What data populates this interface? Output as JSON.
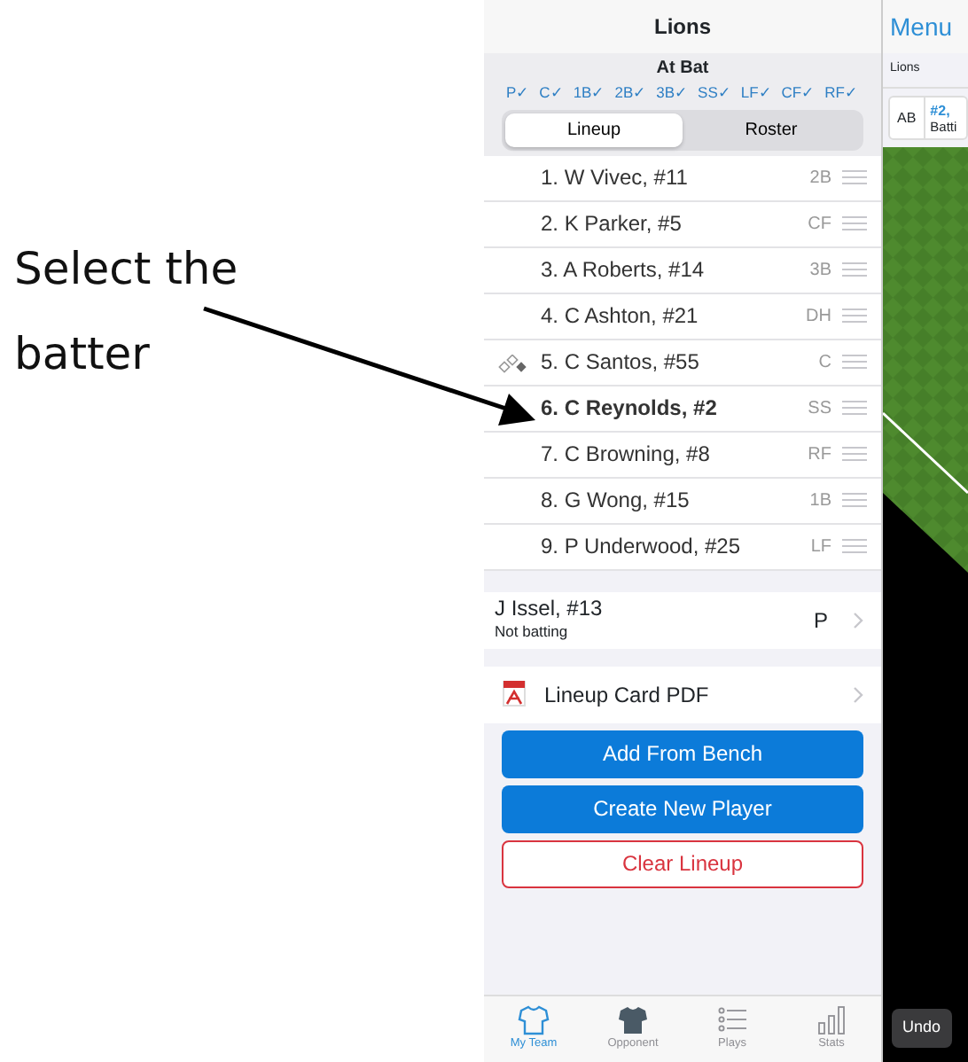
{
  "annotation": {
    "text": "Select the batter"
  },
  "lineup_panel": {
    "title": "Lions",
    "section_title": "At Bat",
    "positions": [
      "P✓",
      "C✓",
      "1B✓",
      "2B✓",
      "3B✓",
      "SS✓",
      "LF✓",
      "CF✓",
      "RF✓"
    ],
    "tabs": [
      {
        "label": "Lineup",
        "selected": true
      },
      {
        "label": "Roster",
        "selected": false
      }
    ],
    "lineup": [
      {
        "text": "1. W Vivec, #11",
        "position": "2B",
        "selected": false,
        "base_icon": false
      },
      {
        "text": "2. K Parker, #5",
        "position": "CF",
        "selected": false,
        "base_icon": false
      },
      {
        "text": "3. A Roberts, #14",
        "position": "3B",
        "selected": false,
        "base_icon": false
      },
      {
        "text": "4. C Ashton, #21",
        "position": "DH",
        "selected": false,
        "base_icon": false
      },
      {
        "text": "5. C Santos, #55",
        "position": "C",
        "selected": false,
        "base_icon": true
      },
      {
        "text": "6. C Reynolds, #2",
        "position": "SS",
        "selected": true,
        "base_icon": false
      },
      {
        "text": "7. C Browning, #8",
        "position": "RF",
        "selected": false,
        "base_icon": false
      },
      {
        "text": "8. G Wong, #15",
        "position": "1B",
        "selected": false,
        "base_icon": false
      },
      {
        "text": "9. P Underwood, #25",
        "position": "LF",
        "selected": false,
        "base_icon": false
      }
    ],
    "pitcher": {
      "name": "J Issel, #13",
      "note": "Not batting",
      "position": "P"
    },
    "pdf": {
      "label": "Lineup Card PDF"
    },
    "buttons": [
      {
        "label": "Add From Bench",
        "kind": "primary"
      },
      {
        "label": "Create New Player",
        "kind": "primary"
      },
      {
        "label": "Clear Lineup",
        "kind": "danger"
      }
    ],
    "tab_bar": [
      {
        "label": "My Team",
        "kind": "jersey-outline",
        "selected": true
      },
      {
        "label": "Opponent",
        "kind": "jersey-filled",
        "selected": false
      },
      {
        "label": "Plays",
        "kind": "list",
        "selected": false
      },
      {
        "label": "Stats",
        "kind": "bars",
        "selected": false
      }
    ]
  },
  "game_panel": {
    "menu": "Menu",
    "team": "Lions",
    "batter_badge": "AB",
    "batter_number": "#2,",
    "batter_note": "Batti",
    "undo": "Undo"
  }
}
